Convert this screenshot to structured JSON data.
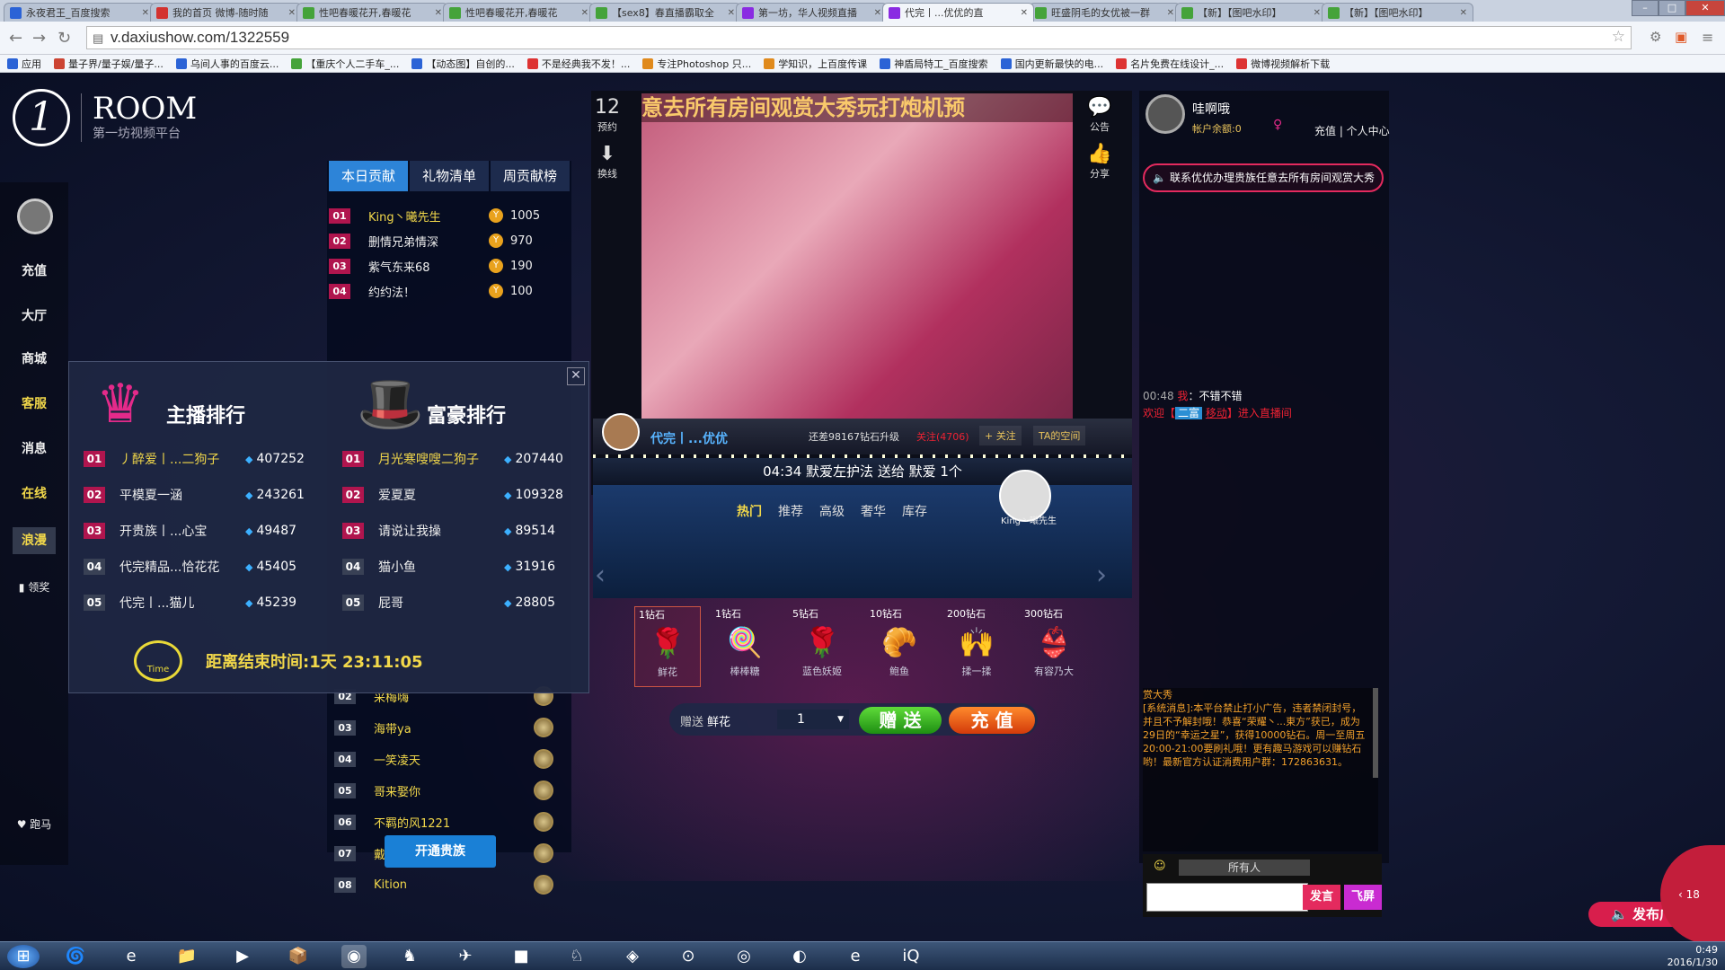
{
  "browser": {
    "tabs": [
      {
        "title": "永夜君王_百度搜索",
        "color": "#2b63d6"
      },
      {
        "title": "我的首页 微博-随时随",
        "color": "#d3322f"
      },
      {
        "title": "性吧春暖花开,春暖花",
        "color": "#45a33a"
      },
      {
        "title": "性吧春暖花开,春暖花",
        "color": "#45a33a"
      },
      {
        "title": "【sex8】春直播霸取全",
        "color": "#45a33a"
      },
      {
        "title": "第一坊，华人视频直播",
        "color": "#8a2be2"
      },
      {
        "title": "代完丨...优优的直",
        "color": "#8a2be2"
      },
      {
        "title": "旺盛阴毛的女优被一群",
        "color": "#45a33a"
      },
      {
        "title": "【新】【图吧水印】",
        "color": "#45a33a"
      },
      {
        "title": "【新】【图吧水印】",
        "color": "#45a33a"
      }
    ],
    "url": "v.daxiushow.com/1322559",
    "bookmarks": [
      "应用",
      "量子界/量子娱/量子...",
      "乌间人事的百度云...",
      "【重庆个人二手车_...",
      "【动态图】自创的...",
      "不是经典我不发！...",
      "专注Photoshop 只...",
      "学知识，上百度传课",
      "神盾局特工_百度搜索",
      "国内更新最快的电...",
      "名片免费在线设计_...",
      "微博视频解析下载"
    ]
  },
  "logo": {
    "title": "ROOM",
    "subtitle": "第一坊视频平台"
  },
  "leftnav": {
    "items": [
      "充值",
      "大厅",
      "商城",
      "客服",
      "消息",
      "在线",
      "浪漫"
    ],
    "reward": "领奖",
    "run": "跑马"
  },
  "rankpanel": {
    "tabs": [
      "本日贡献",
      "礼物清单",
      "周贡献榜"
    ],
    "top_rows": [
      {
        "rank": "01",
        "name": "King丶曦先生",
        "value": "1005"
      },
      {
        "rank": "02",
        "name": "删情兄弟情深",
        "value": "970"
      },
      {
        "rank": "03",
        "name": "紫气东来68",
        "value": "190"
      },
      {
        "rank": "04",
        "name": "约约法！",
        "value": "100"
      }
    ],
    "bottom_rows": [
      {
        "rank": "02",
        "name": "采梅嗨"
      },
      {
        "rank": "03",
        "name": "海带ya"
      },
      {
        "rank": "04",
        "name": "一笑凌天"
      },
      {
        "rank": "05",
        "name": "哥来娶你"
      },
      {
        "rank": "06",
        "name": "不羁的风1221"
      },
      {
        "rank": "07",
        "name": "戴水壹方"
      },
      {
        "rank": "08",
        "name": "Kition"
      }
    ],
    "vip_button": "开通贵族"
  },
  "popup": {
    "anchor_title": "主播排行",
    "rich_title": "富豪排行",
    "anchors": [
      {
        "rank": "01",
        "name": "丿醉爱丨...二狗子",
        "value": "407252"
      },
      {
        "rank": "02",
        "name": "平模夏一涵",
        "value": "243261"
      },
      {
        "rank": "03",
        "name": "开贵族丨...心宝",
        "value": "49487"
      },
      {
        "rank": "04",
        "name": "代完精品...恰花花",
        "value": "45405"
      },
      {
        "rank": "05",
        "name": "代完丨...猫儿",
        "value": "45239"
      }
    ],
    "rich": [
      {
        "rank": "01",
        "name": "月光寒嗖嗖二狗子",
        "value": "207440"
      },
      {
        "rank": "02",
        "name": "爱夏夏",
        "value": "109328"
      },
      {
        "rank": "03",
        "name": "请说让我操",
        "value": "89514"
      },
      {
        "rank": "04",
        "name": "猫小鱼",
        "value": "31916"
      },
      {
        "rank": "05",
        "name": "屁哥",
        "value": "28805"
      }
    ],
    "timer_label": "Time",
    "countdown": "距离结束时间:1天 23:11:05"
  },
  "video": {
    "marquee": "意去所有房间观赏大秀玩打炮机预",
    "left_tools": [
      {
        "icon": "calendar-icon",
        "glyph": "12",
        "label": "预约"
      },
      {
        "icon": "download-icon",
        "glyph": "⬇",
        "label": "换线"
      }
    ],
    "right_tools": [
      {
        "icon": "speech-icon",
        "glyph": "💬",
        "label": "公告"
      },
      {
        "icon": "thumbs-up-icon",
        "glyph": "👍",
        "label": "分享"
      }
    ],
    "host_name": "代完丨...优优",
    "level_text": "还差98167钻石升级",
    "follow_count": "关注(4706)",
    "follow_btn": "+ 关注",
    "space_btn": "TA的空间",
    "gift_message": "04:34 默爱左护法 送给 默爱   1个",
    "guard_name": "King丶曦先生"
  },
  "gifts": {
    "tabs": [
      "热门",
      "推荐",
      "高级",
      "奢华",
      "库存"
    ],
    "items": [
      {
        "price": "1钻石",
        "name": "鲜花",
        "glyph": "🌹"
      },
      {
        "price": "1钻石",
        "name": "棒棒糖",
        "glyph": "🍭"
      },
      {
        "price": "5钻石",
        "name": "蓝色妖姬",
        "glyph": "🌹"
      },
      {
        "price": "10钻石",
        "name": "鲍鱼",
        "glyph": "🥐"
      },
      {
        "price": "200钻石",
        "name": "揉一揉",
        "glyph": "🙌"
      },
      {
        "price": "300钻石",
        "name": "有容乃大",
        "glyph": "👙"
      }
    ],
    "send_label": "赠送",
    "send_gift": "鲜花",
    "qty": "1",
    "send_btn": "赠 送",
    "pay_btn": "充 值"
  },
  "rightpanel": {
    "user_name": "哇啊哦",
    "balance": "帐户余额:0",
    "links": "充值 | 个人中心",
    "notice": "联系优优办理贵族任意去所有房间观赏大秀",
    "chat": [
      {
        "time": "00:48",
        "who": "我",
        "text": "：不错不错"
      },
      {
        "pre": "欢迎【",
        "tag": "二富",
        "name": "移动",
        "post": "】进入直播间"
      }
    ],
    "sys_title": "赏大秀",
    "sys_msg": "[系统消息]:本平台禁止打小广告，违者禁闭封号，并且不予解封哦！恭喜“荣耀丶...東方”获已，成为29日的“幸运之星”，获得10000钻石。周一至周五20:00-21:00要刷礼哦！更有趣马游戏可以赚钻石哟！最新官方认证消费用户群：172863631。",
    "to_all": "所有人",
    "say_btn": "发言",
    "fly_btn": "飞屏",
    "broadcast": "发布广播",
    "side_count": "18"
  },
  "taskbar": {
    "time": "0:49",
    "date": "2016/1/30"
  }
}
